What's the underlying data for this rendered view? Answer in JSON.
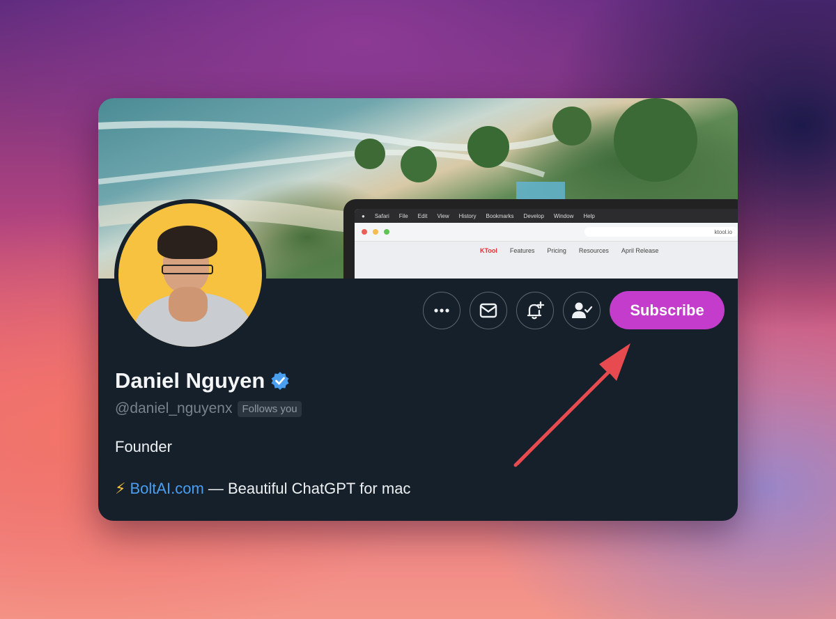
{
  "browser": {
    "menu_items": [
      "Safari",
      "File",
      "Edit",
      "View",
      "History",
      "Bookmarks",
      "Develop",
      "Window",
      "Help"
    ],
    "url": "ktool.io",
    "site_nav": {
      "logo": "KTool",
      "features": "Features",
      "pricing": "Pricing",
      "resources": "Resources",
      "release": "April Release"
    }
  },
  "actions": {
    "more_icon": "more-horizontal-icon",
    "message_icon": "mail-icon",
    "notify_icon": "bell-plus-icon",
    "following_icon": "user-check-icon",
    "subscribe_label": "Subscribe",
    "subscribe_color": "#c43ccb"
  },
  "profile": {
    "name": "Daniel Nguyen",
    "verified_icon": "verified-badge-icon",
    "handle": "@daniel_nguyenx",
    "follows_badge": "Follows you",
    "bio": "Founder",
    "link_emoji": "⚡",
    "link_text": "BoltAI.com",
    "link_suffix": "— Beautiful ChatGPT for mac",
    "link_color": "#4a9ef0"
  }
}
